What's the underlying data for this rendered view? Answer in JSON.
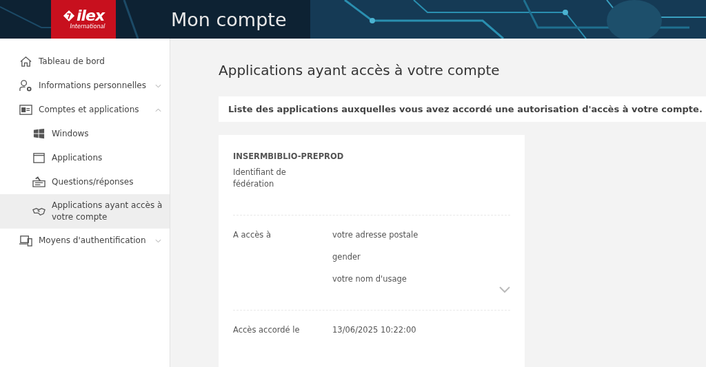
{
  "header": {
    "logo": {
      "name": "ilex",
      "subtitle": "International"
    },
    "title": "Mon compte"
  },
  "sidebar": {
    "items": [
      {
        "label": "Tableau de bord",
        "selected": false
      },
      {
        "label": "Informations personnelles",
        "selected": false,
        "expanded": false
      },
      {
        "label": "Comptes et applications",
        "selected": false,
        "expanded": true,
        "children": [
          {
            "label": "Windows",
            "selected": false
          },
          {
            "label": "Applications",
            "selected": false
          },
          {
            "label": "Questions/réponses",
            "selected": false
          },
          {
            "label": "Applications ayant accès à votre compte",
            "selected": true
          }
        ]
      },
      {
        "label": "Moyens d'authentification",
        "selected": false,
        "expanded": false
      }
    ]
  },
  "page": {
    "title": "Applications ayant accès à votre compte",
    "notice": "Liste des applications auxquelles vous avez accordé une autorisation d'accès à votre compte."
  },
  "card": {
    "name": "INSERMBIBLIO-PREPROD",
    "fields": [
      {
        "label": "Identifiant de fédération"
      },
      {
        "label": "A accès à",
        "values": [
          "votre adresse postale",
          "gender",
          "votre nom d'usage"
        ],
        "expanded": false
      },
      {
        "label": "Accès accordé le",
        "values": [
          "13/06/2025 10:22:00"
        ]
      }
    ]
  }
}
